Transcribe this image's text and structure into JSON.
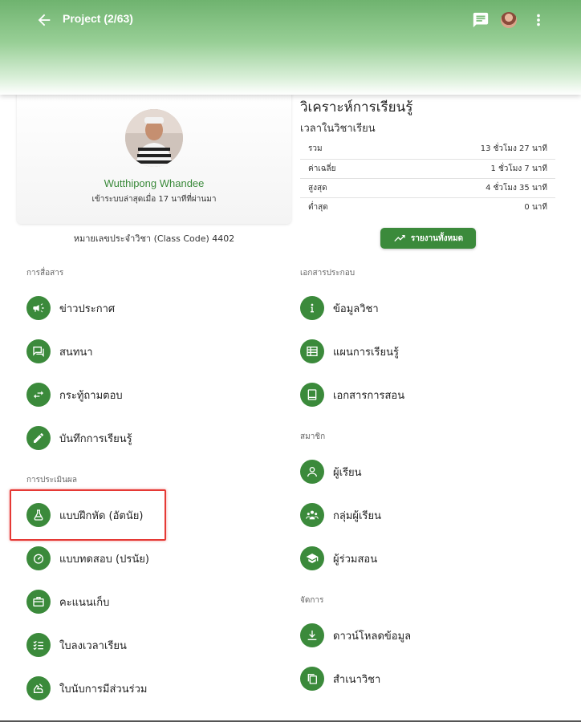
{
  "header": {
    "title": "Project (2/63)",
    "back_icon": "arrow-left-icon",
    "chat_icon": "chat-icon",
    "more_icon": "more-vert-icon"
  },
  "profile": {
    "name": "Wutthipong Whandee",
    "last_login": "เข้าระบบล่าสุดเมื่อ 17 นาทีที่ผ่านมา",
    "class_code": "หมายเลขประจำวิชา (Class Code) 4402"
  },
  "analysis": {
    "title": "วิเคราะห์การเรียนรู้",
    "subtitle": "เวลาในวิชาเรียน",
    "rows": [
      {
        "label": "รวม",
        "value": "13 ชั่วโมง 27 นาที"
      },
      {
        "label": "ค่าเฉลี่ย",
        "value": "1 ชั่วโมง 7 นาที"
      },
      {
        "label": "สูงสุด",
        "value": "4 ชั่วโมง 35 นาที"
      },
      {
        "label": "ต่ำสุด",
        "value": "0 นาที"
      }
    ],
    "report_button": "รายงานทั้งหมด"
  },
  "left_sections": {
    "communication": {
      "title": "การสื่อสาร",
      "items": [
        {
          "label": "ข่าวประกาศ",
          "icon": "megaphone-icon"
        },
        {
          "label": "สนทนา",
          "icon": "forum-icon"
        },
        {
          "label": "กระทู้ถามตอบ",
          "icon": "swap-icon"
        },
        {
          "label": "บันทึกการเรียนรู้",
          "icon": "pencil-icon"
        }
      ]
    },
    "assessment": {
      "title": "การประเมินผล",
      "items": [
        {
          "label": "แบบฝึกหัด (อัตนัย)",
          "icon": "flask-icon"
        },
        {
          "label": "แบบทดสอบ (ปรนัย)",
          "icon": "speedometer-icon"
        },
        {
          "label": "คะแนนเก็บ",
          "icon": "briefcase-icon"
        },
        {
          "label": "ใบลงเวลาเรียน",
          "icon": "checklist-icon"
        },
        {
          "label": "ใบนับการมีส่วนร่วม",
          "icon": "hand-icon"
        }
      ]
    }
  },
  "right_sections": {
    "documents": {
      "title": "เอกสารประกอบ",
      "items": [
        {
          "label": "ข้อมูลวิชา",
          "icon": "info-icon"
        },
        {
          "label": "แผนการเรียนรู้",
          "icon": "table-icon"
        },
        {
          "label": "เอกสารการสอน",
          "icon": "book-icon"
        }
      ]
    },
    "members": {
      "title": "สมาชิก",
      "items": [
        {
          "label": "ผู้เรียน",
          "icon": "person-icon"
        },
        {
          "label": "กลุ่มผู้เรียน",
          "icon": "group-icon"
        },
        {
          "label": "ผู้ร่วมสอน",
          "icon": "graduation-cap-icon"
        }
      ]
    },
    "manage": {
      "title": "จัดการ",
      "items": [
        {
          "label": "ดาวน์โหลดข้อมูล",
          "icon": "download-icon"
        },
        {
          "label": "สำเนาวิชา",
          "icon": "copy-icon"
        }
      ]
    }
  },
  "colors": {
    "accent": "#3b8a3b",
    "highlight": "#e53935"
  }
}
